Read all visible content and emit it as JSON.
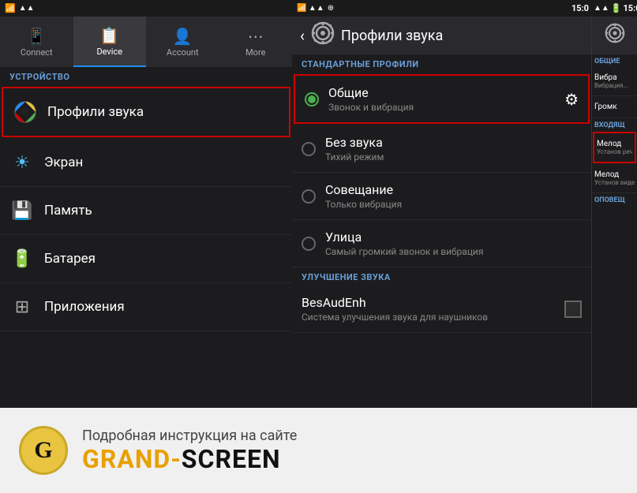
{
  "statusBar": {
    "time": "15:0",
    "signalIcons": "▲▲▲",
    "batteryIcon": "🔋"
  },
  "leftPanel": {
    "tabs": [
      {
        "id": "connect",
        "label": "Connect",
        "icon": "📱",
        "active": false
      },
      {
        "id": "device",
        "label": "Device",
        "icon": "📋",
        "active": true
      },
      {
        "id": "account",
        "label": "Account",
        "icon": "👤",
        "active": false
      },
      {
        "id": "more",
        "label": "More",
        "icon": "⋯",
        "active": false
      }
    ],
    "sectionHeader": "УСТРОЙСТВО",
    "menuItems": [
      {
        "id": "sound-profiles",
        "icon": "🔊",
        "text": "Профили звука",
        "highlighted": true,
        "iconColor": "#e8c440"
      },
      {
        "id": "screen",
        "icon": "☀",
        "text": "Экран",
        "highlighted": false
      },
      {
        "id": "memory",
        "icon": "💾",
        "text": "Память",
        "highlighted": false
      },
      {
        "id": "battery",
        "icon": "🔋",
        "text": "Батарея",
        "highlighted": false
      },
      {
        "id": "apps",
        "icon": "⊞",
        "text": "Приложения",
        "highlighted": false
      }
    ]
  },
  "middlePanel": {
    "title": "Профили звука",
    "standardHeader": "СТАНДАРТНЫЕ ПРОФИЛИ",
    "profiles": [
      {
        "id": "general",
        "name": "Общие",
        "desc": "Звонок и вибрация",
        "selected": true,
        "hasGear": true,
        "active": true
      },
      {
        "id": "silent",
        "name": "Без звука",
        "desc": "Тихий режим",
        "selected": false,
        "hasGear": false,
        "active": false
      },
      {
        "id": "meeting",
        "name": "Совещание",
        "desc": "Только вибрация",
        "selected": false,
        "hasGear": false,
        "active": false
      },
      {
        "id": "street",
        "name": "Улица",
        "desc": "Самый громкий звонок и вибрация",
        "selected": false,
        "hasGear": false,
        "active": false
      }
    ],
    "soundEnhanceHeader": "УЛУЧШЕНИЕ ЗВУКА",
    "enhanceItem": {
      "name": "BesAudEnh",
      "desc": "Система улучшения звука для наушников"
    }
  },
  "rightPanel": {
    "generalHeader": "ОБЩИЕ",
    "items": [
      {
        "id": "vibra1",
        "title": "Вибра",
        "desc": "Вибрация...",
        "highlighted": false
      },
      {
        "id": "volume",
        "title": "Громк",
        "desc": "",
        "highlighted": false
      }
    ],
    "incomingHeader": "ВХОДЯЩ",
    "incomingItems": [
      {
        "id": "melody1",
        "title": "Мелод",
        "desc": "Установ речевых",
        "highlighted": true
      },
      {
        "id": "melody2",
        "title": "Мелод",
        "desc": "Установ видеовы",
        "highlighted": false
      }
    ],
    "notifHeader": "ОПОВЕЩ"
  },
  "banner": {
    "logoLetter": "G",
    "subtitle": "Подробная инструкция на сайте",
    "brandPart1": "GRAND-",
    "brandPart2": "SCREEN"
  }
}
